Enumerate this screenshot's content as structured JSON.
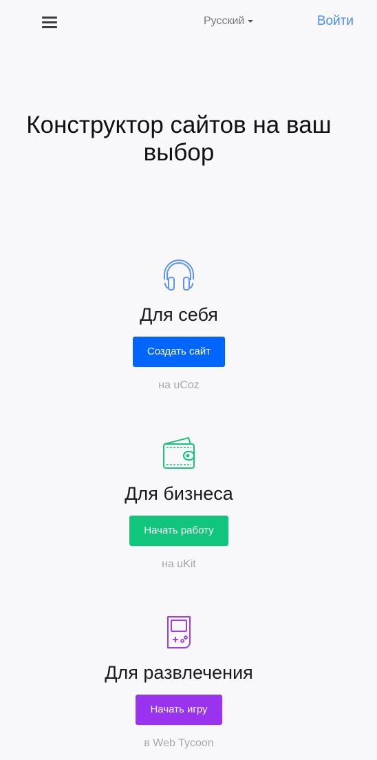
{
  "header": {
    "menu_icon": "hamburger-icon",
    "language": "Русский",
    "login": "Войти"
  },
  "hero": {
    "title": "Конструктор сайтов на ваш выбор"
  },
  "sections": [
    {
      "icon": "headphones-icon",
      "title": "Для себя",
      "button": "Создать сайт",
      "sub": "на uCoz",
      "color": "#0066ff"
    },
    {
      "icon": "wallet-icon",
      "title": "Для бизнеса",
      "button": "Начать работу",
      "sub": "на uKit",
      "color": "#0fc67c"
    },
    {
      "icon": "gamepad-icon",
      "title": "Для развлечения",
      "button": "Начать игру",
      "sub": "в Web Tycoon",
      "color": "#9a33f0"
    }
  ]
}
